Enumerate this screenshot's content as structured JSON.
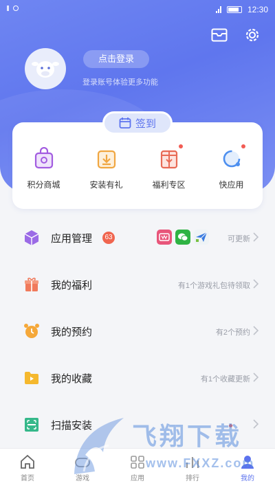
{
  "status_bar": {
    "time": "12:30"
  },
  "header": {
    "login_label": "点击登录",
    "login_hint": "登录账号体验更多功能"
  },
  "checkin": {
    "label": "签到"
  },
  "grid": [
    {
      "label": "积分商城",
      "icon": "shopping-bag-icon",
      "color": "#a25be0",
      "dot": false
    },
    {
      "label": "安装有礼",
      "icon": "download-box-icon",
      "color": "#f0a640",
      "dot": false
    },
    {
      "label": "福利专区",
      "icon": "gift-box-icon",
      "color": "#e86a55",
      "dot": true
    },
    {
      "label": "快应用",
      "icon": "quick-app-icon",
      "color": "#4d8fef",
      "dot": true
    }
  ],
  "list": [
    {
      "label": "应用管理",
      "badge": "63",
      "detail": "可更新",
      "icon": "cube-icon",
      "color": "#9b6be6"
    },
    {
      "label": "我的福利",
      "detail": "有1个游戏礼包待领取",
      "icon": "gift-icon",
      "color": "#f07a5c"
    },
    {
      "label": "我的预约",
      "detail": "有2个预约",
      "icon": "alarm-clock-icon",
      "color": "#f5a83a"
    },
    {
      "label": "我的收藏",
      "detail": "有1个收藏更新",
      "icon": "folder-icon",
      "color": "#f5b82e"
    },
    {
      "label": "扫描安装",
      "detail": "",
      "icon": "scan-icon",
      "color": "#35b88a"
    }
  ],
  "tabs": [
    {
      "label": "首页",
      "icon": "home-icon"
    },
    {
      "label": "游戏",
      "icon": "game-icon"
    },
    {
      "label": "应用",
      "icon": "apps-icon"
    },
    {
      "label": "排行",
      "icon": "rank-icon"
    },
    {
      "label": "我的",
      "icon": "user-icon",
      "active": true
    }
  ],
  "watermark": {
    "text": "飞翔下载",
    "url": "www.FXXZ.com"
  },
  "colors": {
    "primary": "#5c73ee",
    "header_bg": "#6f86f2",
    "badge": "#f0654f"
  }
}
